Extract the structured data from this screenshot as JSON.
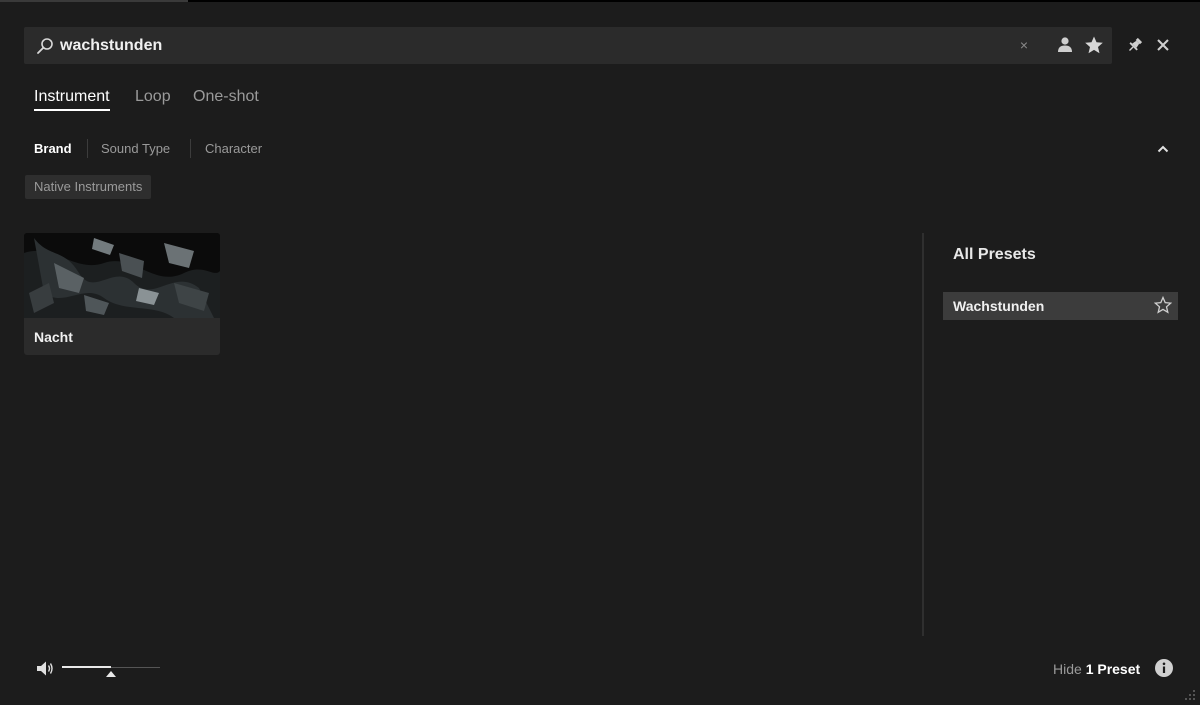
{
  "search": {
    "value": "wachstunden",
    "clear_symbol": "×"
  },
  "tabs": [
    {
      "label": "Instrument",
      "active": true
    },
    {
      "label": "Loop",
      "active": false
    },
    {
      "label": "One-shot",
      "active": false
    }
  ],
  "filters": [
    {
      "label": "Brand",
      "active": true
    },
    {
      "label": "Sound Type",
      "active": false
    },
    {
      "label": "Character",
      "active": false
    }
  ],
  "selected_chip": "Native Instruments",
  "products": [
    {
      "name": "Nacht"
    }
  ],
  "presets_panel": {
    "title": "All Presets",
    "items": [
      {
        "name": "Wachstunden",
        "favorite": false
      }
    ]
  },
  "footer": {
    "volume_fraction": 0.5,
    "hide_label": "Hide",
    "preset_count": "1 Preset"
  },
  "colors": {
    "background": "#1c1c1c",
    "surface": "#2b2b2b",
    "selected_row": "#3c3c3c",
    "text_primary": "#ffffff",
    "text_muted": "#9a9a9a"
  }
}
